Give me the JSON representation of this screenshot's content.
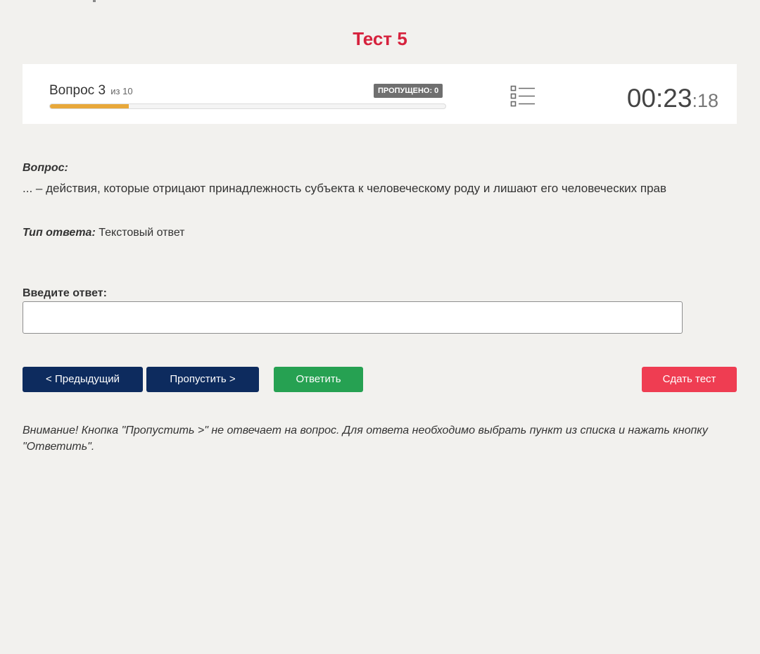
{
  "page": {
    "title": "Тест 5"
  },
  "status": {
    "question_label": "Вопрос 3",
    "of_total": "из 10",
    "skipped_badge": "ПРОПУЩЕНО: 0",
    "progress": 0.2,
    "progress_color": "#e8a83a",
    "timer_main": "00:23",
    "timer_sep": ":",
    "timer_seconds": "18",
    "list_icon": "list-icon"
  },
  "question": {
    "label": "Вопрос:",
    "text": "... – действия, которые отрицают принадлежность субъекта к человеческому роду и лишают его человеческих прав"
  },
  "answer_type": {
    "label": "Тип ответа:",
    "value": "Текстовый ответ"
  },
  "answer_input": {
    "label": "Введите ответ:",
    "value": "",
    "placeholder": ""
  },
  "buttons": {
    "prev": "< Предыдущий",
    "skip": "Пропустить >",
    "answer": "Ответить",
    "finish": "Сдать тест"
  },
  "note": {
    "text": "Внимание! Кнопка \"Пропустить >\" не отвечает на вопрос. Для ответа необходимо выбрать пункт из списка и нажать кнопку \"Ответить\"."
  },
  "colors": {
    "accent_title": "#d6223d",
    "nav_button": "#0d2b5e",
    "answer_button": "#26a152",
    "finish_button": "#ef3d52",
    "background": "#f2f1ee"
  }
}
